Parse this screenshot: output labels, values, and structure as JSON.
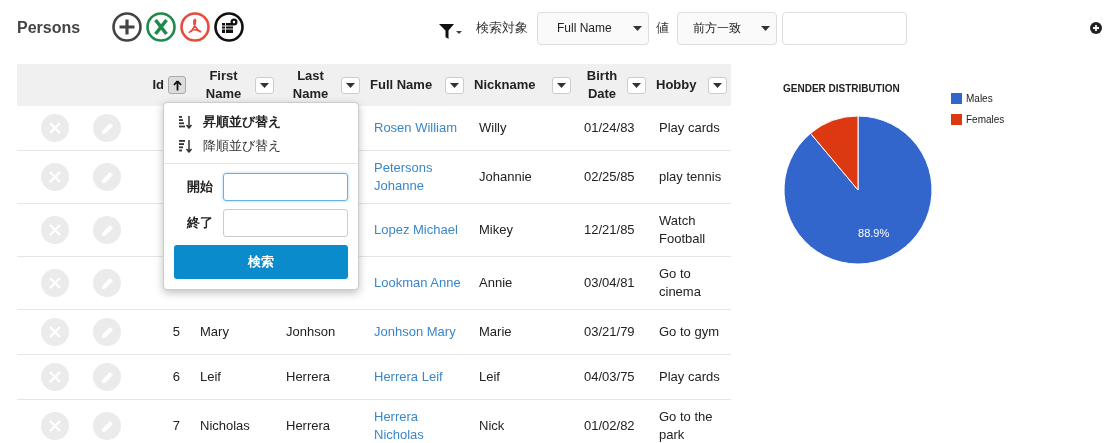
{
  "title": "Persons",
  "toolbar": {
    "filter_label": "検索対象",
    "field_select": "Full Name",
    "value_label": "値",
    "match_select": "前方一致"
  },
  "columns": [
    {
      "label": "Id",
      "kind": "sort"
    },
    {
      "label": "First Name",
      "kind": "filter"
    },
    {
      "label": "Last Name",
      "kind": "filter"
    },
    {
      "label": "Full Name",
      "kind": "filter"
    },
    {
      "label": "Nickname",
      "kind": "filter"
    },
    {
      "label": "Birth Date",
      "kind": "filter"
    },
    {
      "label": "Hobby",
      "kind": "filter"
    }
  ],
  "rows": [
    {
      "full_name": "Rosen William",
      "nickname": "Willy",
      "birth_date": "01/24/83",
      "hobby": "Play cards"
    },
    {
      "full_name": "Petersons Johanne",
      "nickname": "Johannie",
      "birth_date": "02/25/85",
      "hobby": "play tennis"
    },
    {
      "full_name": "Lopez Michael",
      "nickname": "Mikey",
      "birth_date": "12/21/85",
      "hobby": "Watch Football"
    },
    {
      "full_name": "Lookman Anne",
      "nickname": "Annie",
      "birth_date": "03/04/81",
      "hobby": "Go to cinema"
    },
    {
      "id": "5",
      "first_name": "Mary",
      "last_name": "Jonhson",
      "full_name": "Jonhson Mary",
      "nickname": "Marie",
      "birth_date": "03/21/79",
      "hobby": "Go to gym"
    },
    {
      "id": "6",
      "first_name": "Leif",
      "last_name": "Herrera",
      "full_name": "Herrera Leif",
      "nickname": "Leif",
      "birth_date": "04/03/75",
      "hobby": "Play cards"
    },
    {
      "id": "7",
      "first_name": "Nicholas",
      "last_name": "Herrera",
      "full_name": "Herrera Nicholas",
      "nickname": "Nick",
      "birth_date": "01/02/82",
      "hobby": "Go to the park"
    }
  ],
  "popup": {
    "sort_items": [
      {
        "label": "昇順並び替え",
        "kind": "asc",
        "selected": true
      },
      {
        "label": "降順並び替え",
        "kind": "desc",
        "selected": false
      }
    ],
    "start_label": "開始",
    "end_label": "終了",
    "button": "検索"
  },
  "chart": {
    "chart_data": {
      "type": "pie",
      "title": "GENDER DISTRIBUTION",
      "categories": [
        "Males",
        "Females"
      ],
      "values": [
        88.9,
        11.1
      ],
      "colors": [
        "#3366cc",
        "#dc3912"
      ],
      "value_labels": [
        "88.9%",
        null
      ],
      "legend": true
    }
  }
}
